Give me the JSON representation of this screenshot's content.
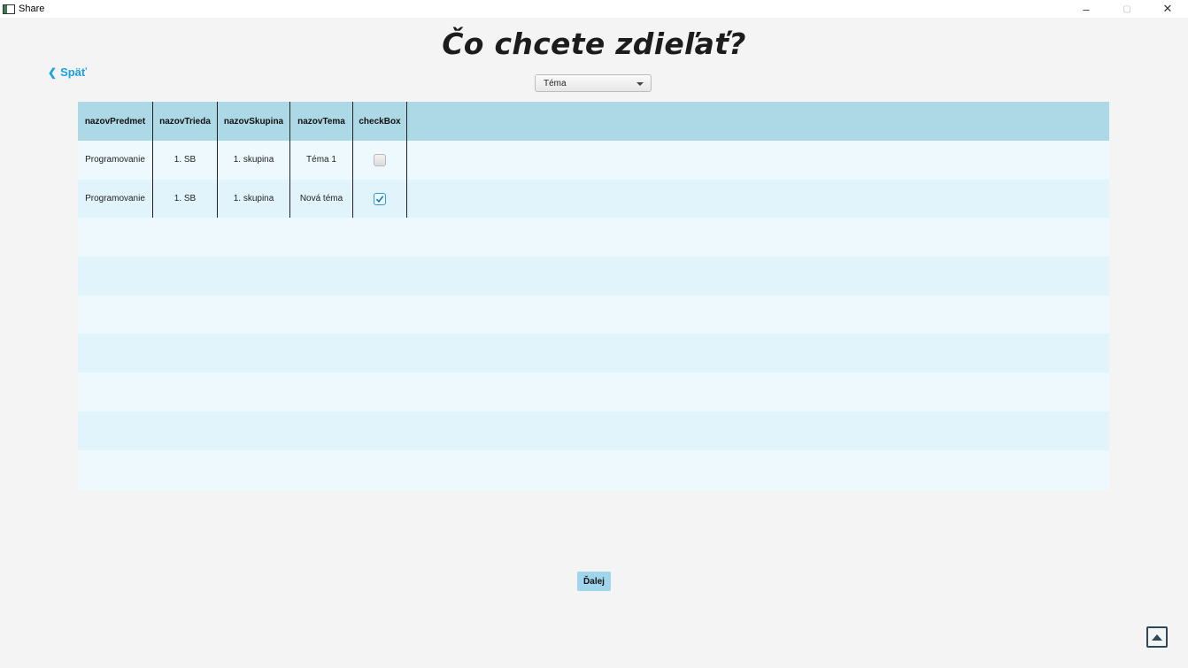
{
  "window": {
    "title": "Share",
    "minimize": "–",
    "restore": "▢",
    "close": "✕"
  },
  "page": {
    "title": "Čo chcete zdieľať?",
    "back_label": "Späť",
    "back_icon": "chevron-left-icon",
    "select_value": "Téma",
    "next_label": "Ďalej",
    "scroll_top_icon": "arrow-up-icon"
  },
  "table": {
    "columns": [
      "nazovPredmet",
      "nazovTrieda",
      "nazovSkupina",
      "nazovTema",
      "checkBox"
    ],
    "rows": [
      {
        "predmet": "Programovanie",
        "trieda": "1. SB",
        "skupina": "1. skupina",
        "tema": "Téma 1",
        "checked": false
      },
      {
        "predmet": "Programovanie",
        "trieda": "1. SB",
        "skupina": "1. skupina",
        "tema": "Nová téma",
        "checked": true
      }
    ]
  },
  "colors": {
    "accent": "#1aa1e6",
    "header_bg": "#add8e6",
    "button_bg": "#9fd6ec"
  }
}
